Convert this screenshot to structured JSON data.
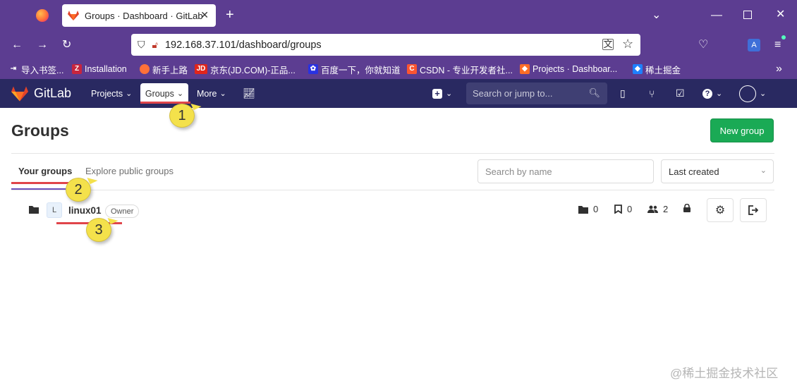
{
  "browser": {
    "tab_title": "Groups · Dashboard · GitLab",
    "new_tab_icon": "plus-icon",
    "url": "192.168.37.101/dashboard/groups",
    "bookmarks": [
      {
        "label": "导入书签...",
        "icon": "import-icon"
      },
      {
        "label": "Installation",
        "icon": "zotero-icon"
      },
      {
        "label": "新手上路",
        "icon": "firefox-icon"
      },
      {
        "label": "京东(JD.COM)-正品...",
        "icon": "jd-icon"
      },
      {
        "label": "百度一下，你就知道",
        "icon": "baidu-icon"
      },
      {
        "label": "CSDN - 专业开发者社...",
        "icon": "csdn-icon"
      },
      {
        "label": "Projects · Dashboar...",
        "icon": "gitlab-icon"
      },
      {
        "label": "稀土掘金",
        "icon": "juejin-icon"
      }
    ]
  },
  "gitlab": {
    "brand": "GitLab",
    "nav": {
      "projects": "Projects",
      "groups": "Groups",
      "more": "More"
    },
    "search_placeholder": "Search or jump to..."
  },
  "page": {
    "title": "Groups",
    "new_group_label": "New group",
    "tabs": {
      "your_groups": "Your groups",
      "explore": "Explore public groups"
    },
    "filter_placeholder": "Search by name",
    "sort_selected": "Last created",
    "groups": [
      {
        "avatar_letter": "L",
        "name": "linux01",
        "role": "Owner",
        "subgroups": "0",
        "projects": "0",
        "members": "2"
      }
    ]
  },
  "annotations": {
    "one": "1",
    "two": "2",
    "three": "3"
  },
  "watermark": "@稀土掘金技术社区",
  "colors": {
    "browser_chrome": "#5c3d91",
    "gitlab_header": "#292961",
    "primary_green": "#1aaa55",
    "annotation_red": "#e0454a",
    "annotation_yellow": "#f4e14b"
  }
}
